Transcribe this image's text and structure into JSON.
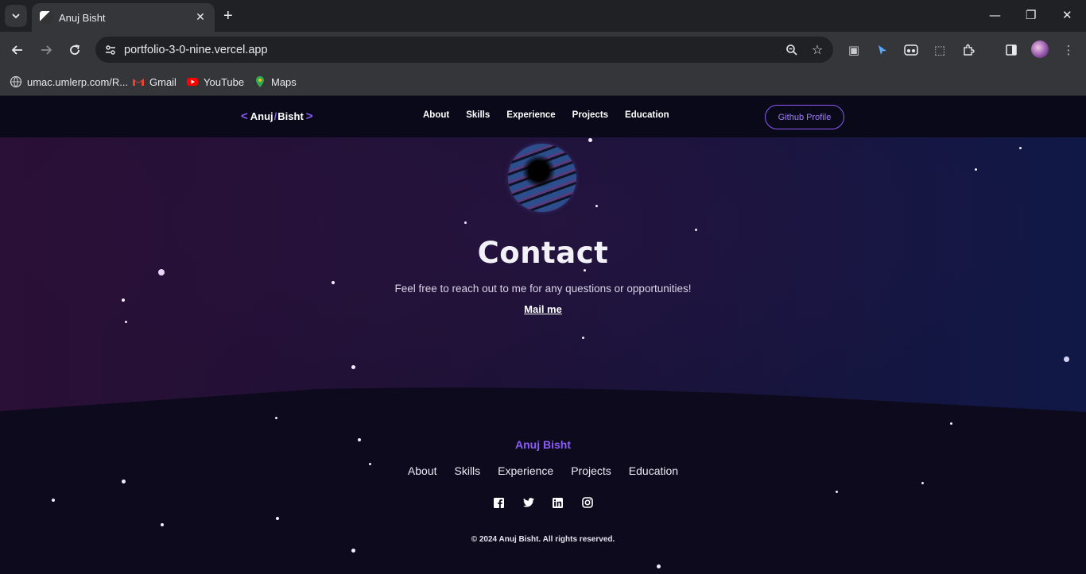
{
  "browser": {
    "tab_title": "Anuj Bisht",
    "url": "portfolio-3-0-nine.vercel.app",
    "bookmarks": [
      {
        "label": "umac.umlerp.com/R...",
        "icon": "globe-icon"
      },
      {
        "label": "Gmail",
        "icon": "gmail-icon"
      },
      {
        "label": "YouTube",
        "icon": "youtube-icon"
      },
      {
        "label": "Maps",
        "icon": "maps-icon"
      }
    ]
  },
  "site": {
    "brand": {
      "first": "Anuj",
      "last": "Bisht"
    },
    "nav": [
      "About",
      "Skills",
      "Experience",
      "Projects",
      "Education"
    ],
    "github_button": "Github Profile",
    "contact": {
      "title": "Contact",
      "subtitle": "Feel free to reach out to me for any questions or opportunities!",
      "mail_link": "Mail me"
    },
    "footer": {
      "name": "Anuj Bisht",
      "links": [
        "About",
        "Skills",
        "Experience",
        "Projects",
        "Education"
      ],
      "socials": [
        "facebook-icon",
        "twitter-icon",
        "linkedin-icon",
        "instagram-icon"
      ],
      "copyright": "© 2024 Anuj Bisht. All rights reserved."
    }
  },
  "colors": {
    "accent": "#8b5cf6",
    "page_bg": "#0c0a1c",
    "chrome_bg": "#35363a"
  }
}
